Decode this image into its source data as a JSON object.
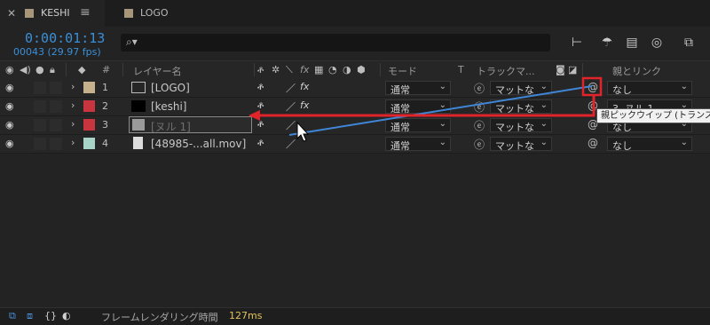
{
  "tabs": [
    {
      "label": "KESHI",
      "active": true,
      "swatch": "#a8967a"
    },
    {
      "label": "LOGO",
      "active": false,
      "swatch": "#a8967a"
    }
  ],
  "timecode": "0:00:01:13",
  "frames": "00043 (29.97 fps)",
  "search": {
    "placeholder": ""
  },
  "headers": {
    "layer_name": "レイヤー名",
    "mode": "モード",
    "t": "T",
    "track_matte": "トラックマ...",
    "parent": "親とリンク",
    "num": "#",
    "fx": "fx"
  },
  "layers": [
    {
      "num": "1",
      "name": "[LOGO]",
      "color": "#c7b18d",
      "mode": "通常",
      "matte": "マットな",
      "parent": "なし",
      "fx": "fx"
    },
    {
      "num": "2",
      "name": "[keshi]",
      "color": "#c8353f",
      "mode": "通常",
      "matte": "マットな",
      "parent": "3. ヌル 1",
      "fx": "fx"
    },
    {
      "num": "3",
      "name": "[ヌル 1]",
      "color": "#c8353f",
      "mode": "通常",
      "matte": "マットな",
      "parent": "なし",
      "fx": ""
    },
    {
      "num": "4",
      "name": "[48985-...all.mov]",
      "color": "#a7d4c6",
      "mode": "通常",
      "matte": "マットな",
      "parent": "なし",
      "fx": ""
    }
  ],
  "tooltip": "親ピックウイップ (トランスフ",
  "footer": {
    "label": "フレームレンダリング時間",
    "time": "127ms"
  },
  "colors": {
    "accent": "#3a8fd9",
    "arrow": "#e0242a",
    "pickwhip": "#3f86d6"
  }
}
